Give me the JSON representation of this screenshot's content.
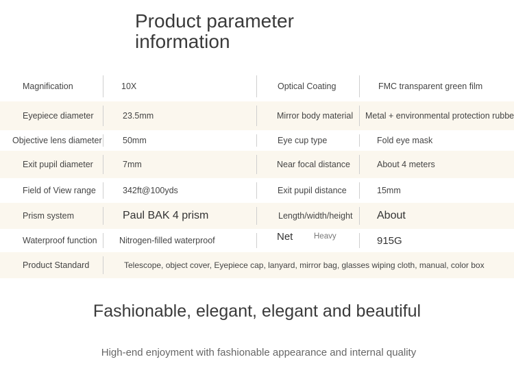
{
  "title": "Product parameter information",
  "rows": [
    {
      "l_label": "Magnification",
      "l_value": "10X",
      "r_label": "Optical Coating",
      "r_value": "FMC transparent green film"
    },
    {
      "l_label": "Eyepiece diameter",
      "l_value": "23.5mm",
      "r_label": "Mirror body material",
      "r_value": "Metal + environmental protection rubber"
    },
    {
      "l_label": "Objective lens diameter",
      "l_value": "50mm",
      "r_label": "Eye cup type",
      "r_value": "Fold eye mask"
    },
    {
      "l_label": "Exit pupil diameter",
      "l_value": "7mm",
      "r_label": "Near focal distance",
      "r_value": "About 4 meters"
    },
    {
      "l_label": "Field of View range",
      "l_value": "342ft@100yds",
      "r_label": "Exit pupil distance",
      "r_value": "15mm"
    },
    {
      "l_label": "Prism system",
      "l_value": "Paul BAK 4 prism",
      "r_label": "Length/width/height",
      "r_value": "About"
    },
    {
      "l_label": "Waterproof function",
      "l_value": "Nitrogen-filled waterproof",
      "r_label_a": "Net",
      "r_label_b": "Heavy",
      "r_value": "915G"
    },
    {
      "l_label": "Product Standard",
      "l_value": "Telescope, object cover, Eyepiece cap, lanyard, mirror bag, glasses wiping cloth, manual, color box"
    }
  ],
  "heading": "Fashionable, elegant, elegant and beautiful",
  "subheading": "High-end enjoyment with fashionable appearance and internal quality"
}
